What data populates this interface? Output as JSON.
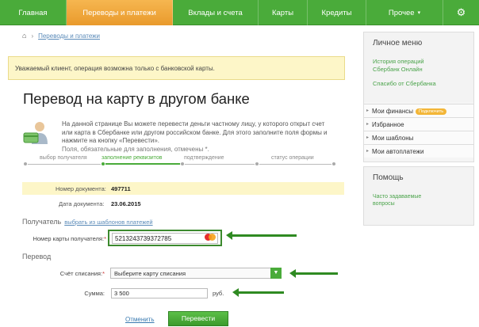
{
  "nav": {
    "tabs": [
      {
        "label": "Главная"
      },
      {
        "label": "Переводы и платежи"
      },
      {
        "label": "Вклады и счета"
      },
      {
        "label": "Карты"
      },
      {
        "label": "Кредиты"
      },
      {
        "label": "Прочее"
      }
    ],
    "more_caret": "▾",
    "settings_icon": "gear-icon"
  },
  "breadcrumb": {
    "home_icon": "home-icon",
    "separator": "›",
    "current": "Переводы и платежи"
  },
  "notice": {
    "text": "Уважаемый клиент, операция возможна только с банковской карты."
  },
  "page": {
    "title": "Перевод на карту в другом банке"
  },
  "intro": {
    "text": "На данной странице Вы можете перевести деньги частному лицу, у которого открыт счет или карта в Сбербанке или другом российском банке. Для этого заполните поля формы и нажмите на кнопку «Перевести».",
    "required_note": "Поля, обязательные для заполнения, отмечены *."
  },
  "steps": [
    {
      "label": "выбор получателя",
      "active": false
    },
    {
      "label": "заполнение реквизитов",
      "active": true
    },
    {
      "label": "подтверждение",
      "active": false
    },
    {
      "label": "статус операции",
      "active": false
    }
  ],
  "document": {
    "number_label": "Номер документа:",
    "number_value": "497711",
    "date_label": "Дата документа:",
    "date_value": "23.06.2015"
  },
  "recipient": {
    "section_title": "Получатель",
    "template_link": "выбрать из шаблонов платежей",
    "card_label": "Номер карты получателя:",
    "required_mark": "*",
    "card_value": "5213243739372785",
    "card_brand_icon": "mastercard-icon"
  },
  "transfer": {
    "section_title": "Перевод",
    "account_label": "Счёт списания:",
    "required_mark": "*",
    "account_placeholder": "Выберите карту списания",
    "amount_label": "Сумма:",
    "amount_value": "3 500",
    "currency": "руб."
  },
  "actions": {
    "cancel_label": "Отменить",
    "submit_label": "Перевести"
  },
  "sidebar": {
    "title": "Личное меню",
    "links": [
      "История операций Сбербанк Онлайн",
      "Спасибо от Сбербанка"
    ],
    "items": [
      {
        "label": "Мои финансы",
        "badge": "Подключить"
      },
      {
        "label": "Избранное"
      },
      {
        "label": "Мои шаблоны"
      },
      {
        "label": "Мои автоплатежи"
      }
    ],
    "item_arrow": "▸"
  },
  "help": {
    "title": "Помощь",
    "link": "Часто задаваемые вопросы"
  },
  "colors": {
    "brand_green": "#4aab3a",
    "active_tab": "#f0a63a",
    "notice_bg": "#fdf6c8",
    "arrow_green": "#2f8a22"
  }
}
